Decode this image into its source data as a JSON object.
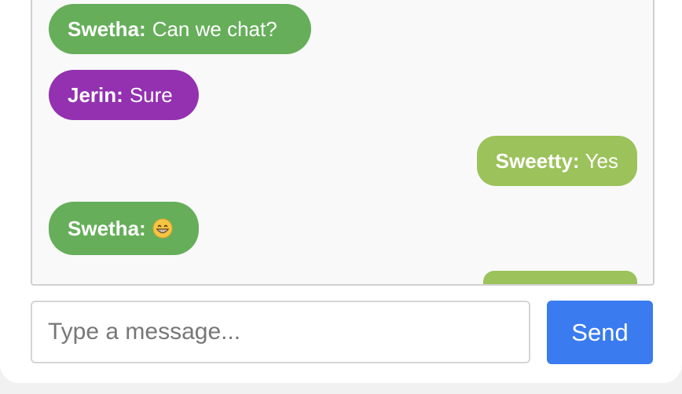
{
  "messages": [
    {
      "sender": "Swetha:",
      "text": "Can we chat?",
      "side": "left",
      "color": "#66ae5a"
    },
    {
      "sender": "Jerin:",
      "text": "Sure",
      "side": "left",
      "color": "#9331b0"
    },
    {
      "sender": "Sweetty:",
      "text": "Yes",
      "side": "right",
      "color": "#9cc25b"
    },
    {
      "sender": "Swetha:",
      "text": "",
      "emoji": "grinning-face-icon",
      "side": "left",
      "color": "#66ae5a"
    },
    {
      "sender": "",
      "text": "",
      "side": "right",
      "color": "#9cc25b"
    }
  ],
  "composer": {
    "placeholder": "Type a message...",
    "value": "",
    "send_label": "Send",
    "send_color": "#3a7bf0"
  }
}
